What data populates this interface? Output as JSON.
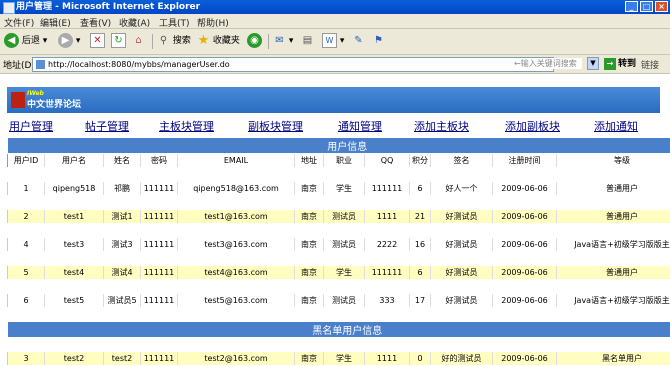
{
  "window": {
    "title": "用户管理 - Microsoft Internet Explorer"
  },
  "menu": [
    "文件(F)",
    "编辑(E)",
    "查看(V)",
    "收藏(A)",
    "工具(T)",
    "帮助(H)"
  ],
  "toolbar": {
    "back": "后退",
    "search": "搜索",
    "favorites": "收藏夹"
  },
  "address": {
    "label": "地址(D)",
    "url": "http://localhost:8080/mybbs/managerUser.do",
    "search_placeholder": "←输入关键词搜索",
    "go": "转到",
    "links": "链接"
  },
  "site": {
    "logo_sub": "IWeb",
    "logo_name": "中文世界论坛"
  },
  "nav": [
    "用户管理",
    "帖子管理",
    "主板块管理",
    "副板块管理",
    "通知管理",
    "添加主板块",
    "添加副板块",
    "添加通知"
  ],
  "user_section": {
    "title": "用户信息",
    "columns": [
      "用户ID",
      "用户名",
      "姓名",
      "密码",
      "EMAIL",
      "地址",
      "职业",
      "QQ",
      "积分",
      "签名",
      "注册时间",
      "等级"
    ],
    "rows": [
      [
        "1",
        "qipeng518",
        "祁鹏",
        "111111",
        "qipeng518@163.com",
        "南京",
        "学生",
        "111111",
        "6",
        "好人一个",
        "2009-06-06",
        "普通用户"
      ],
      [
        "2",
        "test1",
        "测试1",
        "111111",
        "test1@163.com",
        "南京",
        "测试员",
        "1111",
        "21",
        "好测试员",
        "2009-06-06",
        "普通用户"
      ],
      [
        "4",
        "test3",
        "测试3",
        "111111",
        "test3@163.com",
        "南京",
        "测试员",
        "2222",
        "16",
        "好测试员",
        "2009-06-06",
        "Java语言+初级学习版版主"
      ],
      [
        "5",
        "test4",
        "测试4",
        "111111",
        "test4@163.com",
        "南京",
        "学生",
        "111111",
        "6",
        "好测试员",
        "2009-06-06",
        "普通用户"
      ],
      [
        "6",
        "test5",
        "测试员5",
        "111111",
        "test5@163.com",
        "南京",
        "测试员",
        "333",
        "17",
        "好测试员",
        "2009-06-06",
        "Java语言+初级学习版版主"
      ]
    ]
  },
  "blacklist_section": {
    "title": "黑名单用户信息",
    "rows": [
      [
        "3",
        "test2",
        "test2",
        "111111",
        "test2@163.com",
        "南京",
        "学生",
        "1111",
        "0",
        "好的测试员",
        "2009-06-06",
        "黑名单用户"
      ]
    ]
  },
  "colors": {
    "title_bar": "#0246c8",
    "section_header": "#4a7fcc",
    "highlight_row": "#fffdc0",
    "nav_link": "#000080"
  }
}
